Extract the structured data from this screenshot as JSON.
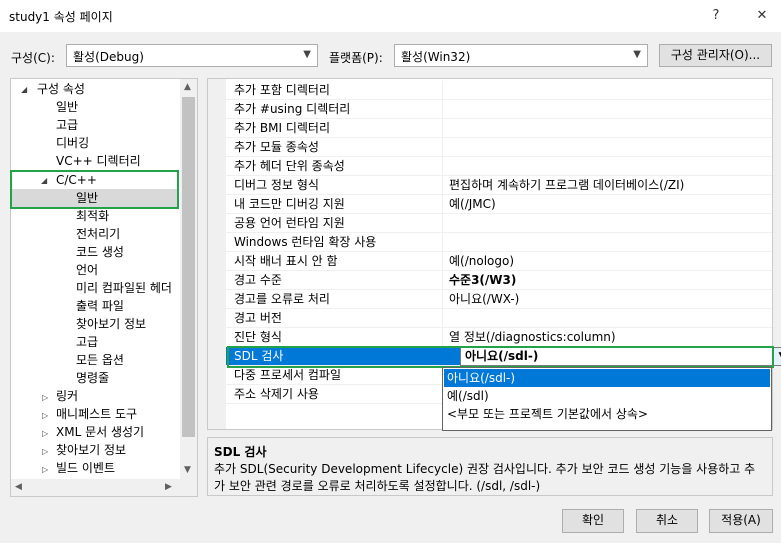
{
  "window": {
    "title": "study1 속성 페이지",
    "help_glyph": "?",
    "close_glyph": "✕"
  },
  "config": {
    "config_label": "구성(C):",
    "config_value": "활성(Debug)",
    "platform_label": "플랫폼(P):",
    "platform_value": "활성(Win32)",
    "manager_button": "구성 관리자(O)..."
  },
  "tree": {
    "items": [
      {
        "label": "구성 속성",
        "expanded": true
      },
      {
        "label": "일반"
      },
      {
        "label": "고급"
      },
      {
        "label": "디버깅"
      },
      {
        "label": "VC++ 디렉터리"
      },
      {
        "label": "C/C++",
        "expanded": true
      },
      {
        "label": "일반",
        "selected": true
      },
      {
        "label": "최적화"
      },
      {
        "label": "전처리기"
      },
      {
        "label": "코드 생성"
      },
      {
        "label": "언어"
      },
      {
        "label": "미리 컴파일된 헤더"
      },
      {
        "label": "출력 파일"
      },
      {
        "label": "찾아보기 정보"
      },
      {
        "label": "고급"
      },
      {
        "label": "모든 옵션"
      },
      {
        "label": "명령줄"
      },
      {
        "label": "링커"
      },
      {
        "label": "매니페스트 도구"
      },
      {
        "label": "XML 문서 생성기"
      },
      {
        "label": "찾아보기 정보"
      },
      {
        "label": "빌드 이벤트"
      }
    ]
  },
  "grid": {
    "rows": [
      {
        "name": "추가 포함 디렉터리",
        "value": ""
      },
      {
        "name": "추가 #using 디렉터리",
        "value": ""
      },
      {
        "name": "추가 BMI 디렉터리",
        "value": ""
      },
      {
        "name": "추가 모듈 종속성",
        "value": ""
      },
      {
        "name": "추가 헤더 단위 종속성",
        "value": ""
      },
      {
        "name": "디버그 정보 형식",
        "value": "편집하며 계속하기 프로그램 데이터베이스(/ZI)"
      },
      {
        "name": "내 코드만 디버깅 지원",
        "value": "예(/JMC)"
      },
      {
        "name": "공용 언어 런타임 지원",
        "value": ""
      },
      {
        "name": "Windows 런타임 확장 사용",
        "value": ""
      },
      {
        "name": "시작 배너 표시 안 함",
        "value": "예(/nologo)"
      },
      {
        "name": "경고 수준",
        "value": "수준3(/W3)"
      },
      {
        "name": "경고를 오류로 처리",
        "value": "아니요(/WX-)"
      },
      {
        "name": "경고 버전",
        "value": ""
      },
      {
        "name": "진단 형식",
        "value": "열 정보(/diagnostics:column)"
      },
      {
        "name": "SDL 검사",
        "value": "아니요(/sdl-)"
      },
      {
        "name": "다중 프로세서 컴파일",
        "value": ""
      },
      {
        "name": "주소 삭제기 사용",
        "value": ""
      }
    ],
    "dropdown_options": [
      "아니요(/sdl-)",
      "예(/sdl)",
      "<부모 또는 프로젝트 기본값에서 상속>"
    ]
  },
  "description": {
    "title": "SDL 검사",
    "text": "추가 SDL(Security Development Lifecycle) 권장 검사입니다. 추가 보안 코드 생성 기능을 사용하고 추가 보안 관련 경로를 오류로 처리하도록 설정합니다. (/sdl, /sdl-)"
  },
  "buttons": {
    "ok": "확인",
    "cancel": "취소",
    "apply": "적용(A)"
  },
  "colors": {
    "selection": "#0078d7",
    "highlight_box": "#22a34a"
  }
}
